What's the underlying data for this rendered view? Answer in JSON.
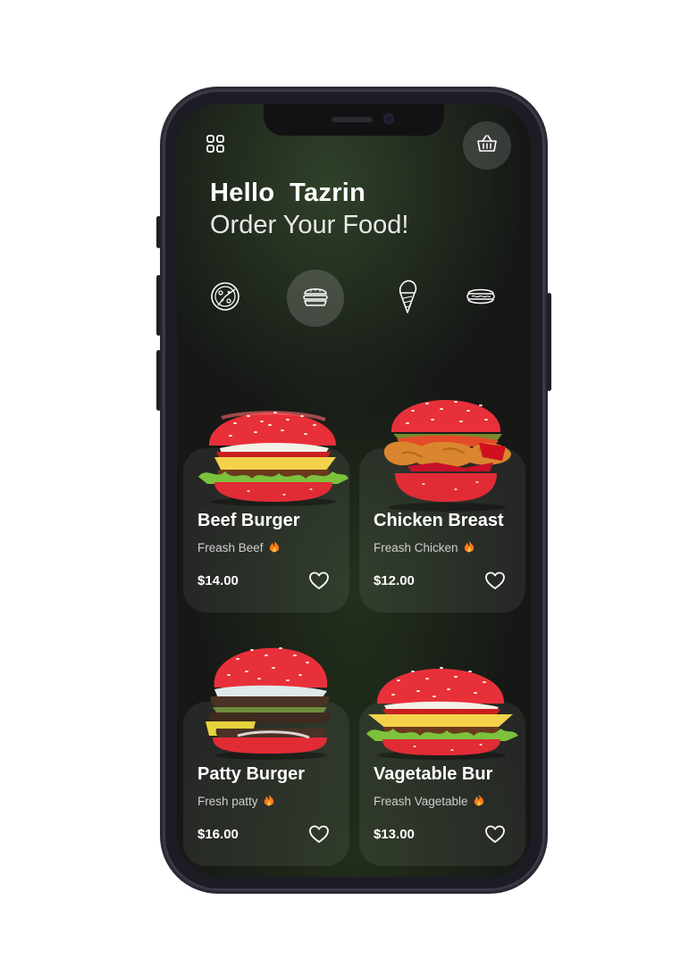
{
  "header": {
    "greeting": "Hello  Tazrin",
    "subtitle": "Order Your Food!"
  },
  "icons": {
    "menu": "grid-menu-icon",
    "cart": "basket-icon"
  },
  "categories": [
    {
      "name": "pizza-icon",
      "active": false
    },
    {
      "name": "burger-icon",
      "active": true
    },
    {
      "name": "ice-cream-icon",
      "active": false
    },
    {
      "name": "hotdog-icon",
      "active": false
    }
  ],
  "products": [
    {
      "name": "Beef Burger",
      "desc": "Freash Beef",
      "price": "$14.00"
    },
    {
      "name": "Chicken Breast",
      "desc": "Freash Chicken",
      "price": "$12.00"
    },
    {
      "name": "Patty Burger",
      "desc": "Fresh patty",
      "price": "$16.00"
    },
    {
      "name": "Vagetable Bur",
      "desc": "Freash Vagetable",
      "price": "$13.00"
    }
  ],
  "colors": {
    "bun": "#e8303a",
    "background": "#161816",
    "flame": "#ff7a1a"
  }
}
